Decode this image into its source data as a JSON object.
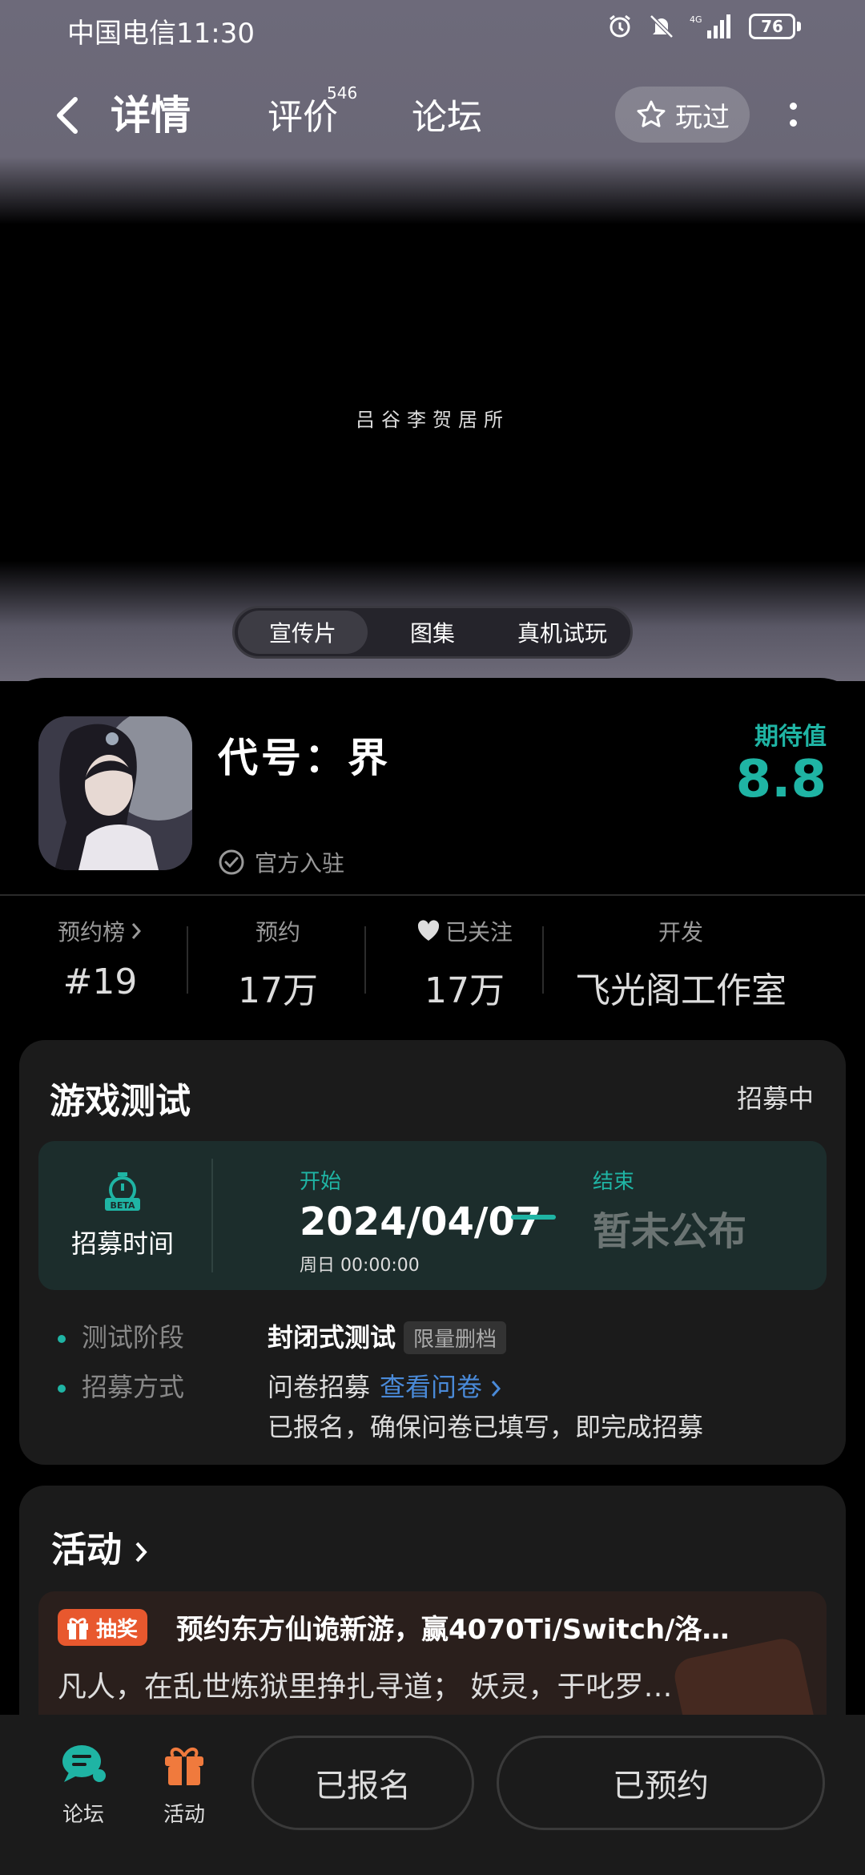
{
  "status_bar": {
    "carrier": "中国电信11:30",
    "battery": "76",
    "network": "4G"
  },
  "navbar": {
    "tab_detail": "详情",
    "tab_review": "评价",
    "review_count": "546",
    "tab_forum": "论坛",
    "played_label": "玩过"
  },
  "video": {
    "caption": "吕谷李贺居所"
  },
  "media_tabs": [
    "宣传片",
    "图集",
    "真机试玩"
  ],
  "game": {
    "name": "代号：界",
    "verified_label": "官方入驻",
    "expect_label": "期待值",
    "expect_value": "8.8"
  },
  "stats": {
    "rank_label": "预约榜",
    "rank_value": "#19",
    "reserve_label": "预约",
    "reserve_value": "17万",
    "follow_label": "已关注",
    "follow_value": "17万",
    "dev_label": "开发",
    "dev_value": "飞光阁工作室"
  },
  "test_card": {
    "title": "游戏测试",
    "status": "招募中",
    "recruit_time_label": "招募时间",
    "start_label": "开始",
    "start_date": "2024/04/07",
    "start_time": "周日  00:00:00",
    "end_label": "结束",
    "end_value": "暂未公布",
    "stage_label": "测试阶段",
    "stage_value": "封闭式测试",
    "stage_badge": "限量删档",
    "method_label": "招募方式",
    "method_value": "问卷招募",
    "method_link": "查看问卷",
    "method_note": "已报名，确保问卷已填写，即完成招募"
  },
  "activity": {
    "title": "活动",
    "badge": "抽奖",
    "headline": "预约东方仙诡新游，赢4070Ti/Switch/洛…",
    "desc": "凡人，在乱世炼狱里挣扎寻道； 妖灵，于叱罗…"
  },
  "bottom_bar": {
    "forum_label": "论坛",
    "activity_label": "活动",
    "signed_label": "已报名",
    "reserved_label": "已预约"
  },
  "colors": {
    "accent": "#1fb4a4",
    "link": "#4a8ad8",
    "lottery": "#e8582e"
  }
}
